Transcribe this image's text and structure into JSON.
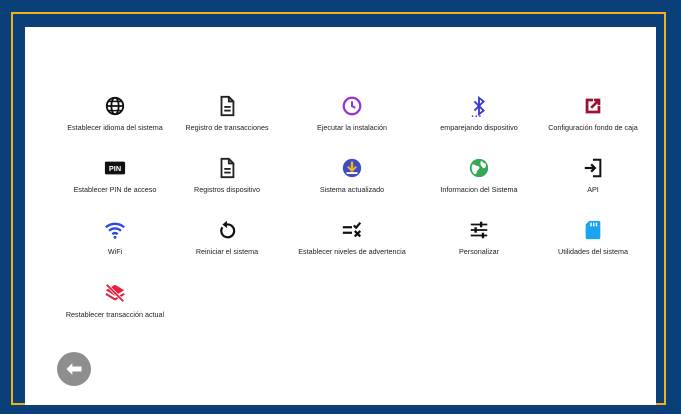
{
  "tiles": [
    {
      "label": "Establecer idioma del sistema",
      "icon": "globe-icon",
      "color": "#111111"
    },
    {
      "label": "Registro de transacciones",
      "icon": "document-icon",
      "color": "#222222"
    },
    {
      "label": "Ejecutar la instalación",
      "icon": "clock-icon",
      "color": "#9b2fd6"
    },
    {
      "label": "emparejando dispositivo",
      "icon": "bluetooth-icon",
      "color": "#3a39d8"
    },
    {
      "label": "Configuración fondo de caja",
      "icon": "open-external-icon",
      "color": "#9a1230"
    },
    {
      "label": "Establecer PIN de acceso",
      "icon": "pin-icon",
      "color": "#111111",
      "pin_text": "PIN"
    },
    {
      "label": "Registros dispositivo",
      "icon": "document-icon",
      "color": "#222222"
    },
    {
      "label": "Sistema actualizado",
      "icon": "download-circle-icon",
      "color": "#3b4bc4"
    },
    {
      "label": "Informacion del Sistema",
      "icon": "earth-icon",
      "color": "#34a853"
    },
    {
      "label": "API",
      "icon": "login-arrow-icon",
      "color": "#111111"
    },
    {
      "label": "WiFi",
      "icon": "wifi-icon",
      "color": "#2f46e8"
    },
    {
      "label": "Reiniciar el sistema",
      "icon": "restart-icon",
      "color": "#111111"
    },
    {
      "label": "Establecer niveles de advertencia",
      "icon": "checklist-icon",
      "color": "#111111"
    },
    {
      "label": "Personalizar",
      "icon": "sliders-icon",
      "color": "#111111"
    },
    {
      "label": "Utilidades del sistema",
      "icon": "sd-card-icon",
      "color": "#1aa3ef"
    },
    {
      "label": "Restablecer transacción actual",
      "icon": "layers-off-icon",
      "color": "#e4203c"
    }
  ]
}
